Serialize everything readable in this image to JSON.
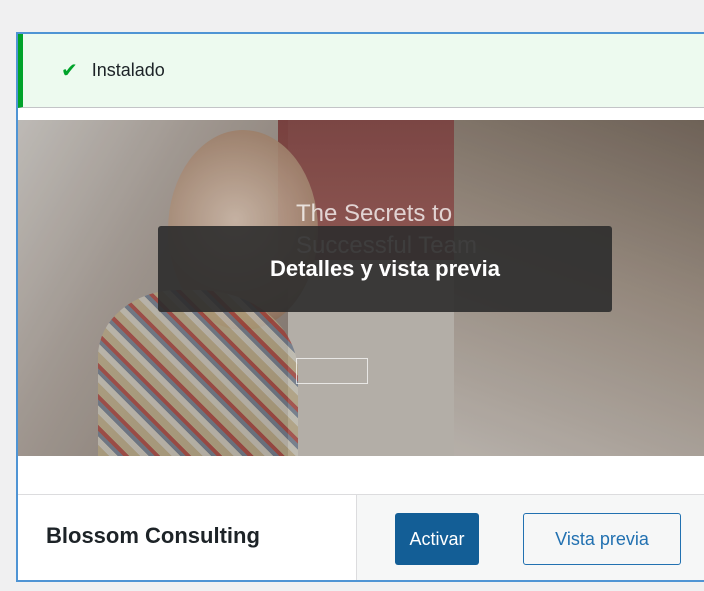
{
  "notice": {
    "icon": "check-icon",
    "text": "Instalado"
  },
  "screenshot": {
    "title": "The Secrets to Successful Team",
    "overlay_label": "Detalles y vista previa"
  },
  "theme": {
    "name": "Blossom Consulting",
    "activate_label": "Activar",
    "preview_label": "Vista previa"
  },
  "colors": {
    "primary": "#135e96",
    "accent": "#2271b1",
    "success": "#00a32a",
    "focus_border": "#4f94d4"
  }
}
